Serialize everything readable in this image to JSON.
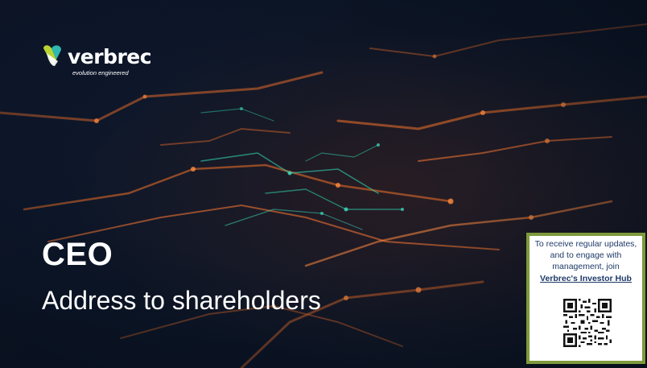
{
  "logo": {
    "word": "verbrec",
    "tagline": "evolution engineered"
  },
  "slide": {
    "title": "CEO",
    "subtitle": "Address to shareholders"
  },
  "investor_hub": {
    "text": "To receive regular updates, and to engage with management, join",
    "link_label": "Verbrec's Investor Hub"
  },
  "colors": {
    "background": "#0b1526",
    "trace_orange": "#e06a2a",
    "trace_teal": "#2fd6b0",
    "box_border": "#7e9a3b",
    "hub_text": "#1f3a68"
  }
}
